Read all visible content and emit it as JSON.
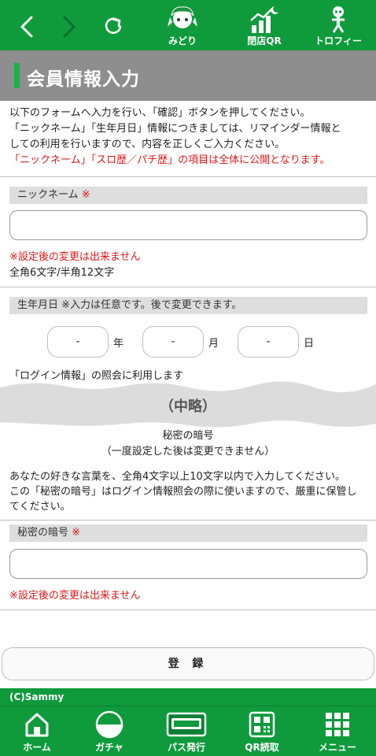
{
  "topbar": {
    "items": [
      {
        "label": "みどり",
        "icon": "midori-character-icon"
      },
      {
        "label": "閉店QR",
        "icon": "closing-qr-chart-icon"
      },
      {
        "label": "トロフィー",
        "icon": "trophy-figure-icon"
      }
    ]
  },
  "header": {
    "title": "会員情報入力"
  },
  "intro": {
    "line1": "以下のフォームへ入力を行い、「確認」ボタンを押してください。",
    "line2": "「ニックネーム」「生年月日」情報につきましては、リマインダー情報と",
    "line3": "しての利用を行いますので、内容を正しくご入力ください。",
    "line4_red": "「ニックネーム」「スロ歴／パチ歴」の項目は全体に公開となります。"
  },
  "nickname": {
    "label": "ニックネーム",
    "required_mark": "※",
    "value": "",
    "note_red": "※設定後の変更は出来ません",
    "note": "全角6文字/半角12文字"
  },
  "birthday": {
    "label": "生年月日 ※入力は任意です。後で変更できます。",
    "year_value": "-",
    "month_value": "-",
    "day_value": "-",
    "year_unit": "年",
    "month_unit": "月",
    "day_unit": "日",
    "note": "「ログイン情報」の照会に利用します"
  },
  "abbreviation": "（中略）",
  "secret": {
    "heading": "秘密の暗号",
    "subheading": "（一度設定した後は変更できません）",
    "para1": "あなたの好きな言葉を、全角4文字以上10文字以内で入力してください。",
    "para2": "この「秘密の暗号」はログイン情報照会の際に使いますので、厳重に保管し",
    "para3": "てください。",
    "label": "秘密の暗号",
    "required_mark": "※",
    "value": "",
    "note_red": "※設定後の変更は出来ません"
  },
  "register_button": "登 録",
  "copyright": "(C)Sammy",
  "bottom_nav": [
    {
      "label": "ホーム",
      "icon": "home-icon"
    },
    {
      "label": "ガチャ",
      "icon": "gacha-ball-icon"
    },
    {
      "label": "パス発行",
      "icon": "push-pass-icon"
    },
    {
      "label": "QR読取",
      "icon": "qr-code-icon"
    },
    {
      "label": "メニュー",
      "icon": "menu-grid-icon"
    }
  ],
  "colors": {
    "brand_green": "#0f9a3c",
    "accent_green": "#17b14a",
    "header_gray": "#8e8e8e",
    "required_red": "#e01818"
  }
}
